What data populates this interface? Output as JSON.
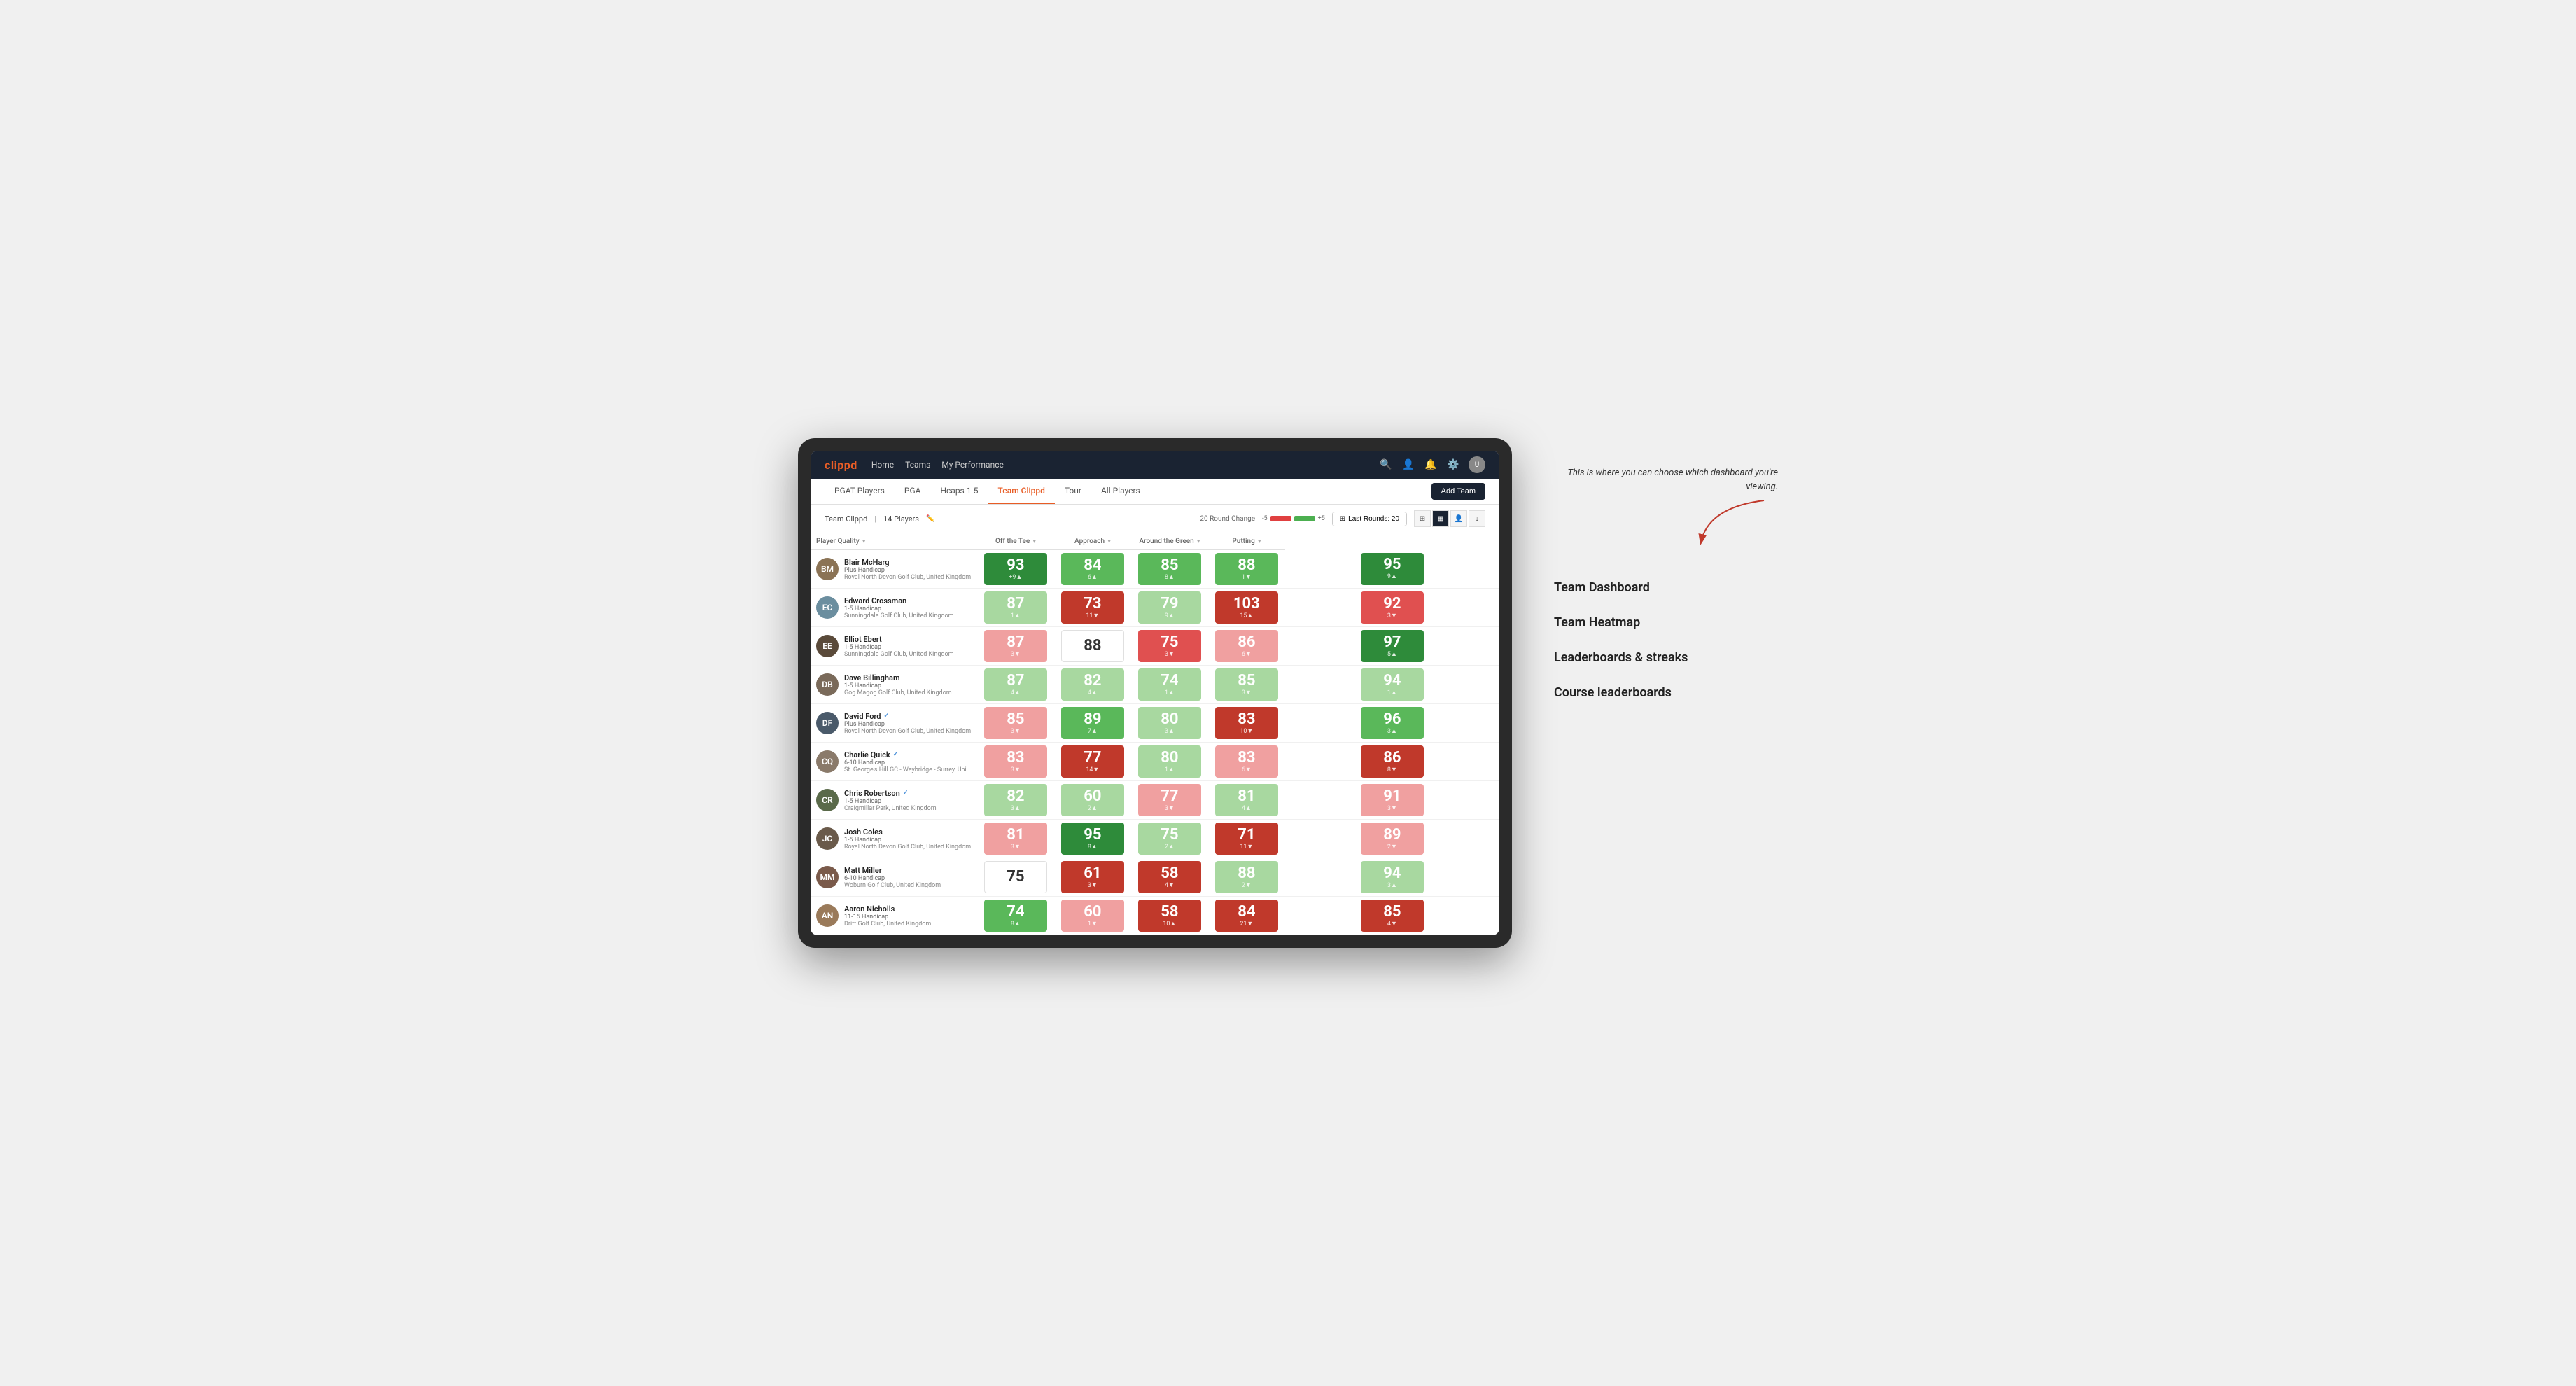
{
  "annotation": {
    "callout_text": "This is where you can choose which dashboard you're viewing.",
    "items": [
      "Team Dashboard",
      "Team Heatmap",
      "Leaderboards & streaks",
      "Course leaderboards"
    ]
  },
  "nav": {
    "logo": "clippd",
    "items": [
      "Home",
      "Teams",
      "My Performance"
    ],
    "icons": [
      "search",
      "person",
      "bell",
      "settings",
      "avatar"
    ]
  },
  "sub_nav": {
    "items": [
      "PGAT Players",
      "PGA",
      "Hcaps 1-5",
      "Team Clippd",
      "Tour",
      "All Players"
    ],
    "active": "Team Clippd",
    "add_team_label": "Add Team"
  },
  "team_header": {
    "team_name": "Team Clippd",
    "player_count": "14 Players",
    "round_change_label": "20 Round Change",
    "bar_neg_label": "-5",
    "bar_pos_label": "+5",
    "last_rounds_label": "Last Rounds: 20"
  },
  "table": {
    "columns": [
      "Player Quality ▾",
      "Off the Tee ▾",
      "Approach ▾",
      "Around the Green ▾",
      "Putting ▾"
    ],
    "rows": [
      {
        "name": "Blair McHarg",
        "handicap": "Plus Handicap",
        "club": "Royal North Devon Golf Club, United Kingdom",
        "avatar_color": "#8B7355",
        "initials": "BM",
        "scores": [
          {
            "value": 93,
            "change": "+9",
            "direction": "up",
            "bg": "bg-green-dark"
          },
          {
            "value": 84,
            "change": "6",
            "direction": "up",
            "bg": "bg-green-mid"
          },
          {
            "value": 85,
            "change": "8",
            "direction": "up",
            "bg": "bg-green-mid"
          },
          {
            "value": 88,
            "change": "1",
            "direction": "down",
            "bg": "bg-green-mid"
          },
          {
            "value": 95,
            "change": "9",
            "direction": "up",
            "bg": "bg-green-dark"
          }
        ]
      },
      {
        "name": "Edward Crossman",
        "handicap": "1-5 Handicap",
        "club": "Sunningdale Golf Club, United Kingdom",
        "avatar_color": "#6B8E9F",
        "initials": "EC",
        "scores": [
          {
            "value": 87,
            "change": "1",
            "direction": "up",
            "bg": "bg-green-light"
          },
          {
            "value": 73,
            "change": "11",
            "direction": "down",
            "bg": "bg-red-dark"
          },
          {
            "value": 79,
            "change": "9",
            "direction": "up",
            "bg": "bg-green-light"
          },
          {
            "value": 103,
            "change": "15",
            "direction": "up",
            "bg": "bg-red-dark"
          },
          {
            "value": 92,
            "change": "3",
            "direction": "down",
            "bg": "bg-red-mid"
          }
        ]
      },
      {
        "name": "Elliot Ebert",
        "handicap": "1-5 Handicap",
        "club": "Sunningdale Golf Club, United Kingdom",
        "avatar_color": "#5a4a3a",
        "initials": "EE",
        "scores": [
          {
            "value": 87,
            "change": "3",
            "direction": "down",
            "bg": "bg-red-light"
          },
          {
            "value": 88,
            "change": "",
            "direction": "",
            "bg": "bg-white"
          },
          {
            "value": 75,
            "change": "3",
            "direction": "down",
            "bg": "bg-red-mid"
          },
          {
            "value": 86,
            "change": "6",
            "direction": "down",
            "bg": "bg-red-light"
          },
          {
            "value": 97,
            "change": "5",
            "direction": "up",
            "bg": "bg-green-dark"
          }
        ]
      },
      {
        "name": "Dave Billingham",
        "handicap": "1-5 Handicap",
        "club": "Gog Magog Golf Club, United Kingdom",
        "avatar_color": "#7a6a5a",
        "initials": "DB",
        "scores": [
          {
            "value": 87,
            "change": "4",
            "direction": "up",
            "bg": "bg-green-light"
          },
          {
            "value": 82,
            "change": "4",
            "direction": "up",
            "bg": "bg-green-light"
          },
          {
            "value": 74,
            "change": "1",
            "direction": "up",
            "bg": "bg-green-light"
          },
          {
            "value": 85,
            "change": "3",
            "direction": "down",
            "bg": "bg-green-light"
          },
          {
            "value": 94,
            "change": "1",
            "direction": "up",
            "bg": "bg-green-light"
          }
        ]
      },
      {
        "name": "David Ford",
        "handicap": "Plus Handicap",
        "club": "Royal North Devon Golf Club, United Kingdom",
        "avatar_color": "#4a5a6a",
        "initials": "DF",
        "verified": true,
        "scores": [
          {
            "value": 85,
            "change": "3",
            "direction": "down",
            "bg": "bg-red-light"
          },
          {
            "value": 89,
            "change": "7",
            "direction": "up",
            "bg": "bg-green-mid"
          },
          {
            "value": 80,
            "change": "3",
            "direction": "up",
            "bg": "bg-green-light"
          },
          {
            "value": 83,
            "change": "10",
            "direction": "down",
            "bg": "bg-red-dark"
          },
          {
            "value": 96,
            "change": "3",
            "direction": "up",
            "bg": "bg-green-mid"
          }
        ]
      },
      {
        "name": "Charlie Quick",
        "handicap": "6-10 Handicap",
        "club": "St. George's Hill GC - Weybridge - Surrey, Uni...",
        "avatar_color": "#8a7a6a",
        "initials": "CQ",
        "verified": true,
        "scores": [
          {
            "value": 83,
            "change": "3",
            "direction": "down",
            "bg": "bg-red-light"
          },
          {
            "value": 77,
            "change": "14",
            "direction": "down",
            "bg": "bg-red-dark"
          },
          {
            "value": 80,
            "change": "1",
            "direction": "up",
            "bg": "bg-green-light"
          },
          {
            "value": 83,
            "change": "6",
            "direction": "down",
            "bg": "bg-red-light"
          },
          {
            "value": 86,
            "change": "8",
            "direction": "down",
            "bg": "bg-red-dark"
          }
        ]
      },
      {
        "name": "Chris Robertson",
        "handicap": "1-5 Handicap",
        "club": "Craigmillar Park, United Kingdom",
        "avatar_color": "#5a6a4a",
        "initials": "CR",
        "verified": true,
        "scores": [
          {
            "value": 82,
            "change": "3",
            "direction": "up",
            "bg": "bg-green-light"
          },
          {
            "value": 60,
            "change": "2",
            "direction": "up",
            "bg": "bg-green-light"
          },
          {
            "value": 77,
            "change": "3",
            "direction": "down",
            "bg": "bg-red-light"
          },
          {
            "value": 81,
            "change": "4",
            "direction": "up",
            "bg": "bg-green-light"
          },
          {
            "value": 91,
            "change": "3",
            "direction": "down",
            "bg": "bg-red-light"
          }
        ]
      },
      {
        "name": "Josh Coles",
        "handicap": "1-5 Handicap",
        "club": "Royal North Devon Golf Club, United Kingdom",
        "avatar_color": "#6a5a4a",
        "initials": "JC",
        "scores": [
          {
            "value": 81,
            "change": "3",
            "direction": "down",
            "bg": "bg-red-light"
          },
          {
            "value": 95,
            "change": "8",
            "direction": "up",
            "bg": "bg-green-dark"
          },
          {
            "value": 75,
            "change": "2",
            "direction": "up",
            "bg": "bg-green-light"
          },
          {
            "value": 71,
            "change": "11",
            "direction": "down",
            "bg": "bg-red-dark"
          },
          {
            "value": 89,
            "change": "2",
            "direction": "down",
            "bg": "bg-red-light"
          }
        ]
      },
      {
        "name": "Matt Miller",
        "handicap": "6-10 Handicap",
        "club": "Woburn Golf Club, United Kingdom",
        "avatar_color": "#7a5a4a",
        "initials": "MM",
        "scores": [
          {
            "value": 75,
            "change": "",
            "direction": "",
            "bg": "bg-white"
          },
          {
            "value": 61,
            "change": "3",
            "direction": "down",
            "bg": "bg-red-dark"
          },
          {
            "value": 58,
            "change": "4",
            "direction": "down",
            "bg": "bg-red-dark"
          },
          {
            "value": 88,
            "change": "2",
            "direction": "down",
            "bg": "bg-green-light"
          },
          {
            "value": 94,
            "change": "3",
            "direction": "up",
            "bg": "bg-green-light"
          }
        ]
      },
      {
        "name": "Aaron Nicholls",
        "handicap": "11-15 Handicap",
        "club": "Drift Golf Club, United Kingdom",
        "avatar_color": "#9a7a5a",
        "initials": "AN",
        "scores": [
          {
            "value": 74,
            "change": "8",
            "direction": "up",
            "bg": "bg-green-mid"
          },
          {
            "value": 60,
            "change": "1",
            "direction": "down",
            "bg": "bg-red-light"
          },
          {
            "value": 58,
            "change": "10",
            "direction": "up",
            "bg": "bg-red-dark"
          },
          {
            "value": 84,
            "change": "21",
            "direction": "down",
            "bg": "bg-red-dark"
          },
          {
            "value": 85,
            "change": "4",
            "direction": "down",
            "bg": "bg-red-dark"
          }
        ]
      }
    ]
  }
}
